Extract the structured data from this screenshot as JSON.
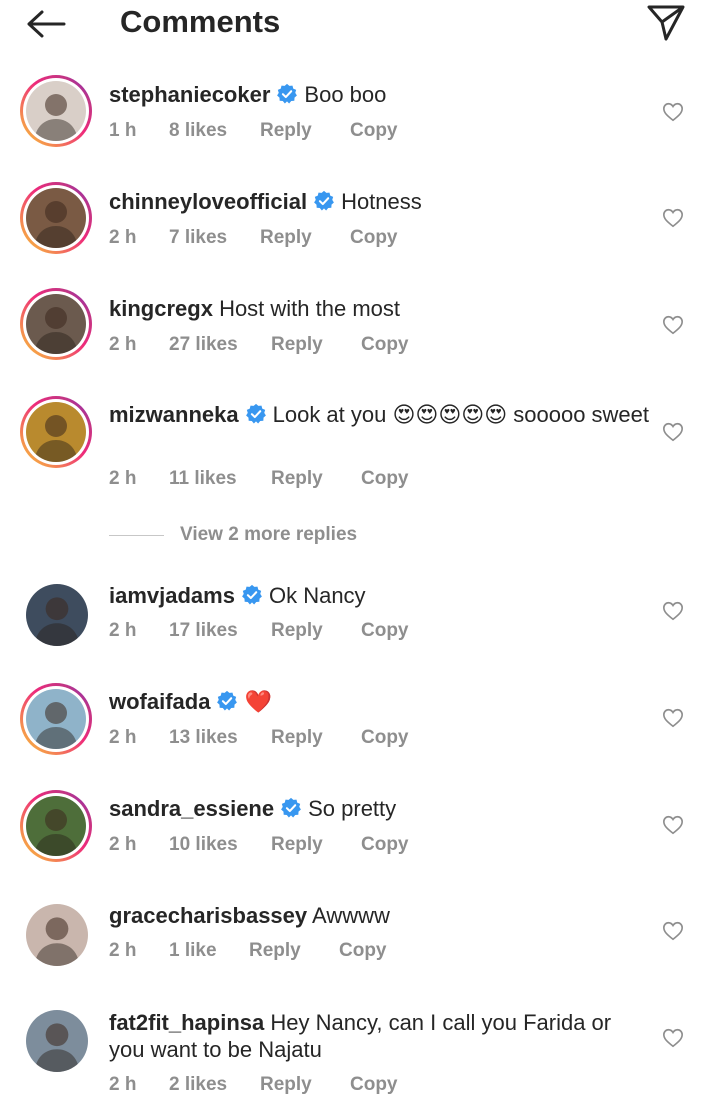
{
  "header": {
    "title": "Comments",
    "back_icon": "arrow-left-icon",
    "send_icon": "paper-plane-icon"
  },
  "actions": {
    "reply": "Reply",
    "copy": "Copy"
  },
  "view_replies": "View 2 more replies",
  "comments": [
    {
      "username": "stephaniecoker",
      "verified": true,
      "text": "Boo boo",
      "time": "1 h",
      "likes": "8 likes",
      "avatar_color": "#d9cfc8"
    },
    {
      "username": "chinneyloveofficial",
      "verified": true,
      "text": "Hotness",
      "time": "2 h",
      "likes": "7 likes",
      "avatar_color": "#7a5a44"
    },
    {
      "username": "kingcregx",
      "verified": false,
      "text": "Host with the most",
      "time": "2 h",
      "likes": "27 likes",
      "avatar_color": "#6b5a4e"
    },
    {
      "username": "mizwanneka",
      "verified": true,
      "text": "Look at you 😍😍😍😍😍 sooooo sweet",
      "time": "2 h",
      "likes": "11 likes",
      "avatar_color": "#b98a2e"
    },
    {
      "username": "iamvjadams",
      "verified": true,
      "text": "Ok Nancy",
      "time": "2 h",
      "likes": "17 likes",
      "avatar_color": "#3e4c5e"
    },
    {
      "username": "wofaifada",
      "verified": true,
      "text": "❤️",
      "time": "2 h",
      "likes": "13 likes",
      "avatar_color": "#8fb3c9"
    },
    {
      "username": "sandra_essiene",
      "verified": true,
      "text": "So pretty",
      "time": "2 h",
      "likes": "10 likes",
      "avatar_color": "#4e6e3a"
    },
    {
      "username": "gracecharisbassey",
      "verified": false,
      "text": "Awwww",
      "time": "2 h",
      "likes": "1 like",
      "avatar_color": "#c9b6ad"
    },
    {
      "username": "fat2fit_hapinsa",
      "verified": false,
      "text": "Hey Nancy, can I call you Farida or you want to be Najatu",
      "time": "2 h",
      "likes": "2 likes",
      "avatar_color": "#7d8d9c"
    }
  ],
  "colors": {
    "verified": "#3897f0",
    "meta": "#8e8e8e",
    "text": "#262626"
  }
}
